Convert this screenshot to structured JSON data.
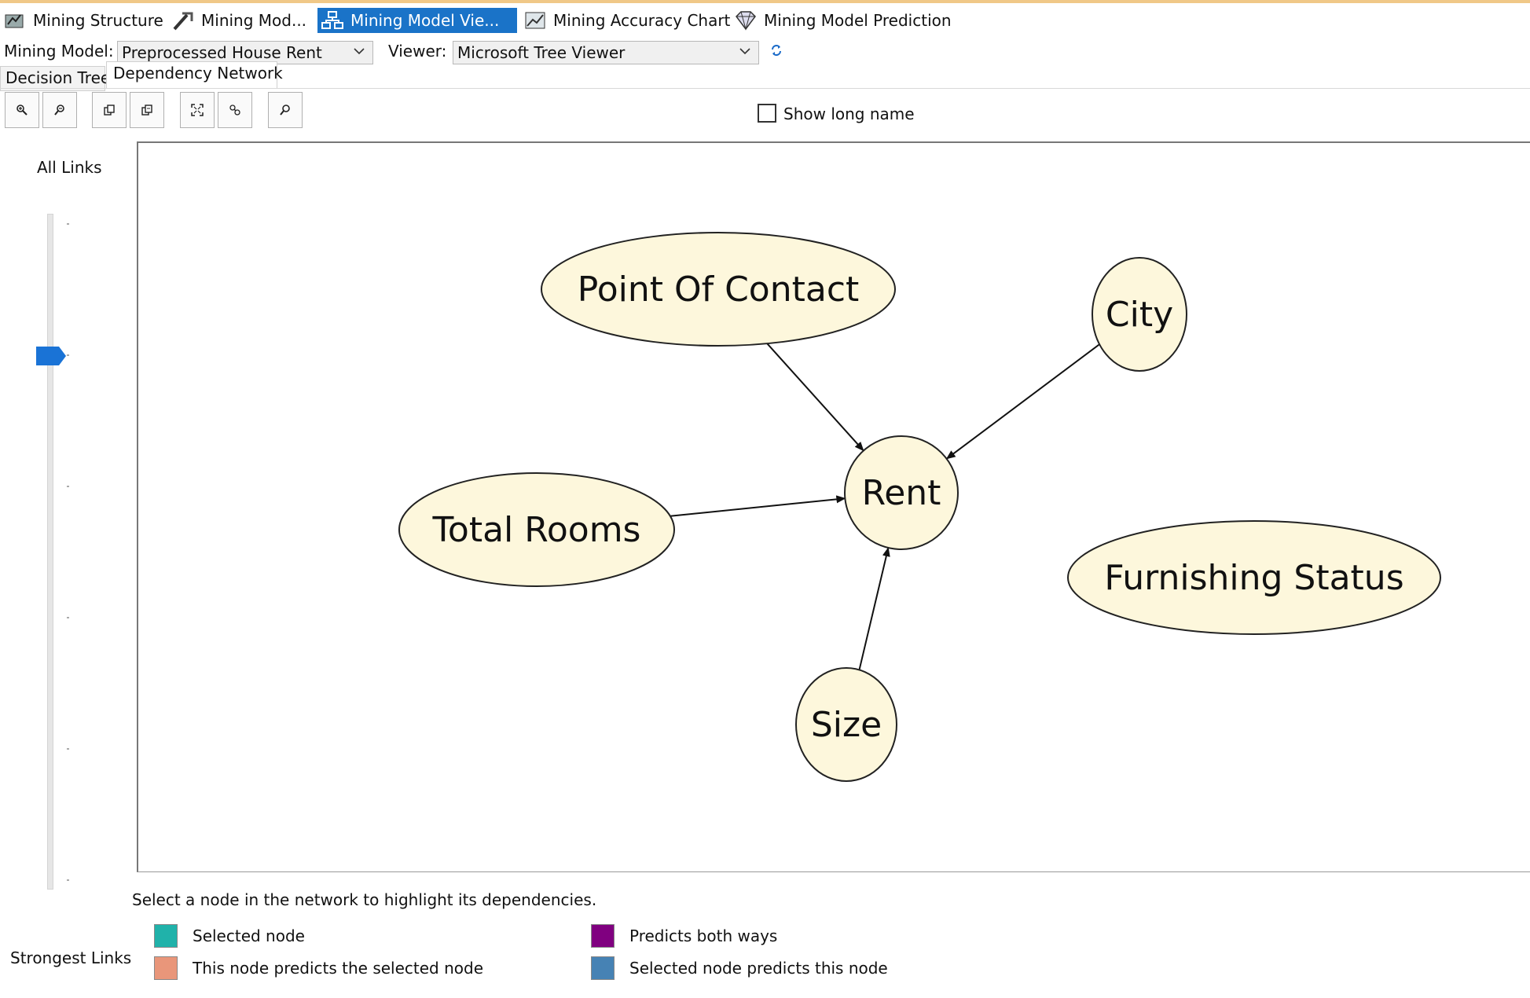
{
  "designer_tabs": [
    {
      "label": "Mining Structure",
      "icon": "mining-structure-icon"
    },
    {
      "label": "Mining Mod...",
      "icon": "mining-models-icon"
    },
    {
      "label": "Mining Model Vie...",
      "icon": "mining-model-viewer-icon",
      "active": true
    },
    {
      "label": "Mining Accuracy Chart",
      "icon": "accuracy-chart-icon"
    },
    {
      "label": "Mining Model Prediction",
      "icon": "prediction-icon"
    }
  ],
  "model_bar": {
    "model_label": "Mining Model:",
    "model_value": "Preprocessed House Rent",
    "viewer_label": "Viewer:",
    "viewer_value": "Microsoft Tree Viewer"
  },
  "sub_tabs": [
    "Decision Tree",
    "Dependency Network"
  ],
  "toolbar": {
    "buttons": [
      "zoom-in-icon",
      "zoom-out-icon",
      "copy-graph-icon",
      "copy-view-icon",
      "fit-to-window-icon",
      "find-node-icon",
      "search-icon"
    ],
    "show_long_name": "Show long name",
    "show_long_name_checked": false
  },
  "slider": {
    "top_label": "All Links",
    "bottom_label": "Strongest Links",
    "level_fraction_from_top": 0.21
  },
  "network": {
    "nodes": [
      {
        "id": "poc",
        "label": "Point Of Contact"
      },
      {
        "id": "city",
        "label": "City"
      },
      {
        "id": "rent",
        "label": "Rent"
      },
      {
        "id": "rooms",
        "label": "Total Rooms"
      },
      {
        "id": "furnish",
        "label": "Furnishing Status"
      },
      {
        "id": "size",
        "label": "Size"
      }
    ],
    "edges": [
      {
        "from": "poc",
        "to": "rent"
      },
      {
        "from": "city",
        "to": "rent"
      },
      {
        "from": "rooms",
        "to": "rent"
      },
      {
        "from": "size",
        "to": "rent"
      }
    ],
    "node_fill": "#fdf7dc",
    "node_stroke": "#222222"
  },
  "hint": "Select a node in the network to highlight its dependencies.",
  "legend": [
    {
      "label": "Selected node",
      "color": "#20b2aa"
    },
    {
      "label": "This node predicts the selected node",
      "color": "#e9967a"
    },
    {
      "label": "Predicts both ways",
      "color": "#800080"
    },
    {
      "label": "Selected node predicts this node",
      "color": "#4682b4"
    }
  ]
}
